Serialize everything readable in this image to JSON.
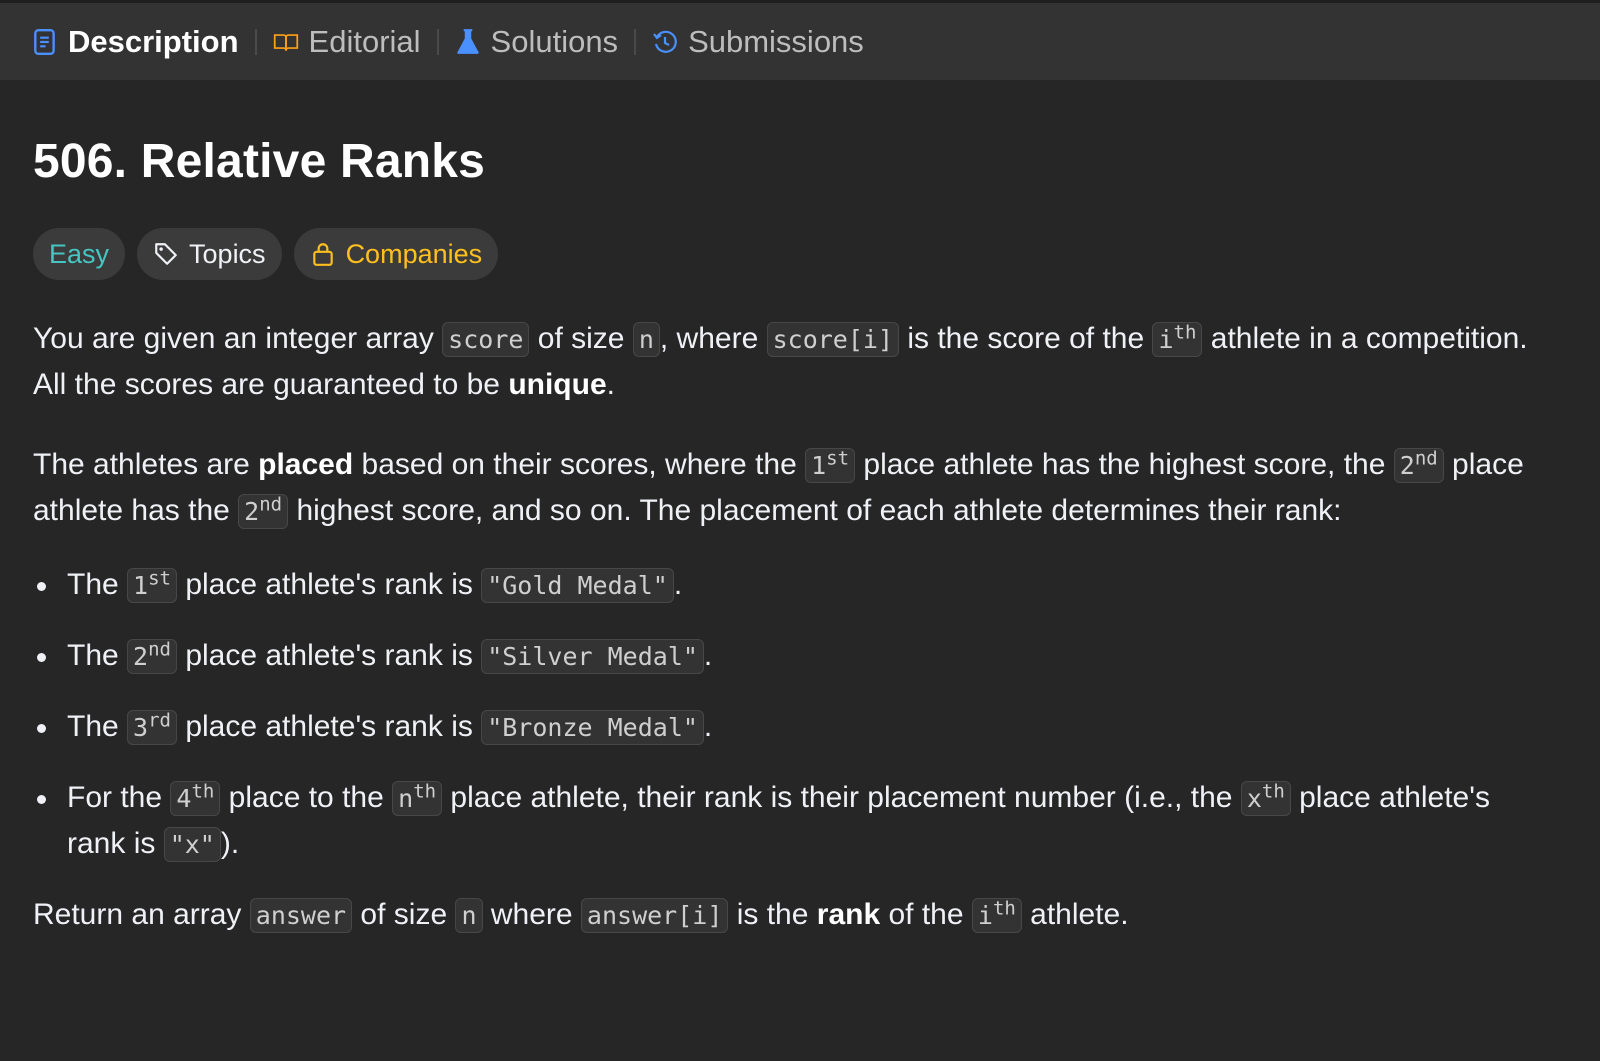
{
  "tabs": [
    {
      "label": "Description",
      "icon": "description-icon",
      "active": true
    },
    {
      "label": "Editorial",
      "icon": "book-icon",
      "active": false
    },
    {
      "label": "Solutions",
      "icon": "flask-icon",
      "active": false
    },
    {
      "label": "Submissions",
      "icon": "history-icon",
      "active": false
    }
  ],
  "problem": {
    "title": "506. Relative Ranks",
    "difficulty": "Easy",
    "topics_label": "Topics",
    "companies_label": "Companies"
  },
  "colors": {
    "easy": "#46c6c2",
    "companies": "#ffc01e",
    "active_tab_icon": "#4a90ff",
    "background": "#262626",
    "tabbar": "#333333"
  },
  "text": {
    "p1_a": "You are given an integer array ",
    "code_score": "score",
    "p1_b": " of size ",
    "code_n": "n",
    "p1_c": ", where ",
    "code_score_i": "score[i]",
    "p1_d": " is the score of the ",
    "code_i": "i",
    "sup_th": "th",
    "p1_e": " athlete in a competition.",
    "p1_f": "All the scores are guaranteed to be ",
    "unique": "unique",
    "period": ".",
    "p2_a": "The athletes are ",
    "placed": "placed",
    "p2_b": " based on their scores, where the ",
    "num_1": "1",
    "sup_st": "st",
    "p2_c": " place athlete has the highest score, the ",
    "num_2": "2",
    "sup_nd": "nd",
    "p2_d": " place",
    "p2_e": "athlete has the ",
    "p2_f": " highest score, and so on. The placement of each athlete determines their rank:",
    "li_the": "The ",
    "li_rank_is": " place athlete's rank is ",
    "gold": "\"Gold Medal\"",
    "silver": "\"Silver Medal\"",
    "bronze": "\"Bronze Medal\"",
    "num_3": "3",
    "sup_rd": "rd",
    "li4_a": "For the ",
    "num_4": "4",
    "li4_b": " place to the ",
    "li4_c": " place athlete, their rank is their placement number (i.e., the ",
    "code_x": "x",
    "li4_d": " place athlete's",
    "li4_e": "rank is ",
    "code_x_str": "\"x\"",
    "li4_f": ").",
    "p4_a": "Return an array ",
    "code_answer": "answer",
    "p4_b": " of size ",
    "p4_c": " where ",
    "code_answer_i": "answer[i]",
    "p4_d": " is the ",
    "rank": "rank",
    "p4_e": " of the ",
    "p4_f": " athlete."
  }
}
